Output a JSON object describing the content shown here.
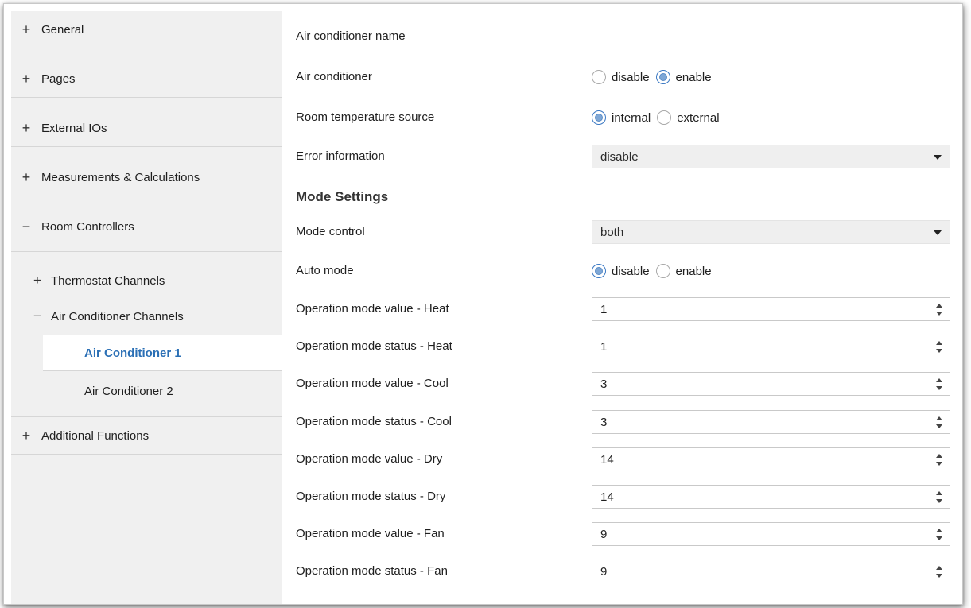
{
  "sidebar": {
    "items": [
      {
        "symbol": "+",
        "label": "General"
      },
      {
        "symbol": "+",
        "label": "Pages"
      },
      {
        "symbol": "+",
        "label": "External IOs"
      },
      {
        "symbol": "+",
        "label": "Measurements & Calculations"
      },
      {
        "symbol": "−",
        "label": "Room Controllers"
      },
      {
        "symbol": "+",
        "label": "Additional Functions"
      }
    ],
    "sub": [
      {
        "symbol": "+",
        "label": "Thermostat Channels"
      },
      {
        "symbol": "−",
        "label": "Air Conditioner Channels"
      }
    ],
    "leaves": [
      {
        "label": "Air Conditioner 1",
        "active": true
      },
      {
        "label": "Air Conditioner 2",
        "active": false
      }
    ]
  },
  "form": {
    "name": {
      "label": "Air conditioner name",
      "value": ""
    },
    "ac": {
      "label": "Air conditioner",
      "options": [
        "disable",
        "enable"
      ],
      "selected": "enable"
    },
    "temp_source": {
      "label": "Room temperature source",
      "options": [
        "internal",
        "external"
      ],
      "selected": "internal"
    },
    "error_info": {
      "label": "Error information",
      "value": "disable"
    },
    "mode_section": "Mode Settings",
    "mode_control": {
      "label": "Mode control",
      "value": "both"
    },
    "auto_mode": {
      "label": "Auto mode",
      "options": [
        "disable",
        "enable"
      ],
      "selected": "disable"
    },
    "spins": [
      {
        "label": "Operation mode value - Heat",
        "value": "1"
      },
      {
        "label": "Operation mode status - Heat",
        "value": "1"
      },
      {
        "label": "Operation mode value - Cool",
        "value": "3"
      },
      {
        "label": "Operation mode status - Cool",
        "value": "3"
      },
      {
        "label": "Operation mode value - Dry",
        "value": "14"
      },
      {
        "label": "Operation mode status - Dry",
        "value": "14"
      },
      {
        "label": "Operation mode value - Fan",
        "value": "9"
      },
      {
        "label": "Operation mode status - Fan",
        "value": "9"
      }
    ]
  },
  "colors": {
    "accent": "#2a6fb5",
    "sidebar_bg": "#f0f0f0",
    "radio_on": "#7ea7d6"
  }
}
